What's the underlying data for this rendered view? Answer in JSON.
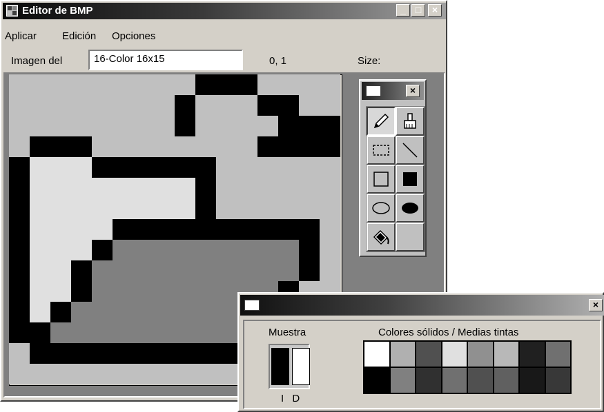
{
  "main_window": {
    "title": "Editor de BMP",
    "controls": {
      "minimize": "_",
      "maximize": "□",
      "close": "×"
    }
  },
  "menu": [
    "Aplicar",
    "Edición",
    "Opciones"
  ],
  "toolbar": {
    "image_label": "Imagen del",
    "image_value": "16-Color 16x15",
    "coordinates": "0, 1",
    "size_label": "Size:"
  },
  "pixel_grid": {
    "columns": 16,
    "rows": 15,
    "palette": {
      "K": "#000000",
      "L": "#c0c0c0",
      "W": "#e0e0e0",
      "D": "#808080"
    },
    "pixels": [
      "LLLLLLLLLKKKLLLL",
      "LLLLLLLLKLLLKKLL",
      "LLLLLLLLKLLLLKKK",
      "LKKKLLLLLLLLKKKK",
      "KWWWKKKKKKLLLLLL",
      "KWWWWWWWWKLLLLLL",
      "KWWWWWWWWKLLLLLL",
      "KWWWWKKKKKKKKKKL",
      "KWWWKDDDDDDDDDKL",
      "KWWKDDDDDDDDDDKL",
      "KWWKDDDDDDDDDKLL",
      "KWKDDDDDDDDDDKLL",
      "KKDDDDDDDDDDDKLL",
      "LKKKKKKKKKKKKLLL",
      "LLLLLLLLLLLLLLLL"
    ]
  },
  "tool_palette": {
    "tools": [
      {
        "name": "pencil",
        "icon": "pencil-icon"
      },
      {
        "name": "brush",
        "icon": "brush-icon"
      },
      {
        "name": "select",
        "icon": "dashed-rect-icon"
      },
      {
        "name": "line",
        "icon": "line-icon"
      },
      {
        "name": "rectangle",
        "icon": "rect-outline-icon"
      },
      {
        "name": "filled-rectangle",
        "icon": "rect-filled-icon"
      },
      {
        "name": "ellipse",
        "icon": "ellipse-outline-icon"
      },
      {
        "name": "filled-ellipse",
        "icon": "ellipse-filled-icon"
      },
      {
        "name": "fill",
        "icon": "paint-bucket-icon"
      }
    ]
  },
  "color_dialog": {
    "sample_label": "Muestra",
    "sample_caption": "I D",
    "palette_label": "Colores sólidos / Medias tintas",
    "sample_colors": {
      "left": "#000000",
      "right": "#ffffff"
    },
    "colors": [
      "#ffffff",
      "#b0b0b0",
      "#505050",
      "#e0e0e0",
      "#909090",
      "#b8b8b8",
      "#202020",
      "#707070",
      "#000000",
      "#808080",
      "#303030",
      "#707070",
      "#505050",
      "#606060",
      "#181818",
      "#383838"
    ]
  }
}
